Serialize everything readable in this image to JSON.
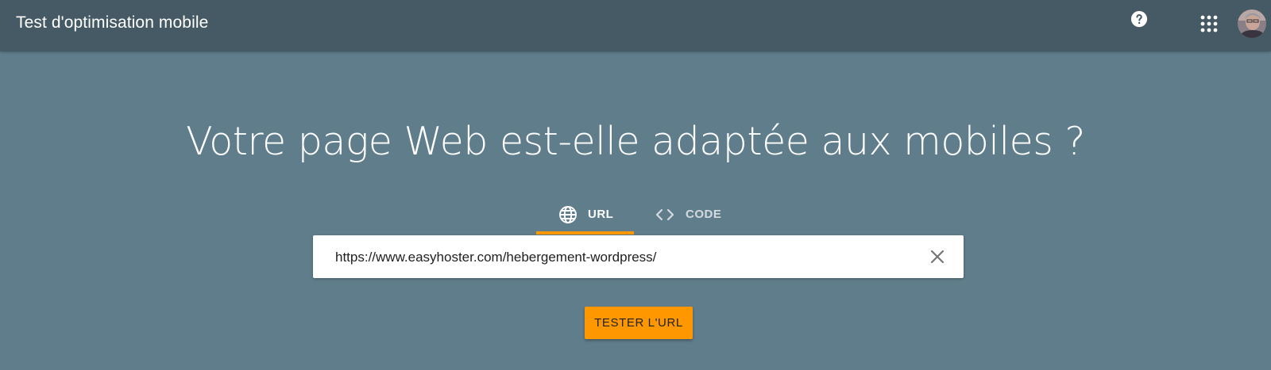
{
  "header": {
    "title": "Test d'optimisation mobile",
    "help_icon": "help-circle-icon",
    "apps_icon": "apps-grid-icon",
    "avatar_icon": "user-avatar"
  },
  "main": {
    "headline": "Votre page Web est-elle adaptée aux mobiles ?",
    "tabs": [
      {
        "label": "URL",
        "icon": "globe-icon",
        "selected": true
      },
      {
        "label": "CODE",
        "icon": "code-icon",
        "selected": false
      }
    ],
    "url_input": {
      "value": "https://www.easyhoster.com/hebergement-wordpress/"
    },
    "clear_icon": "close-icon",
    "submit_label": "TESTER L'URL"
  },
  "colors": {
    "header_bg": "#455a64",
    "page_bg": "#607d8b",
    "accent": "#ff9800"
  }
}
